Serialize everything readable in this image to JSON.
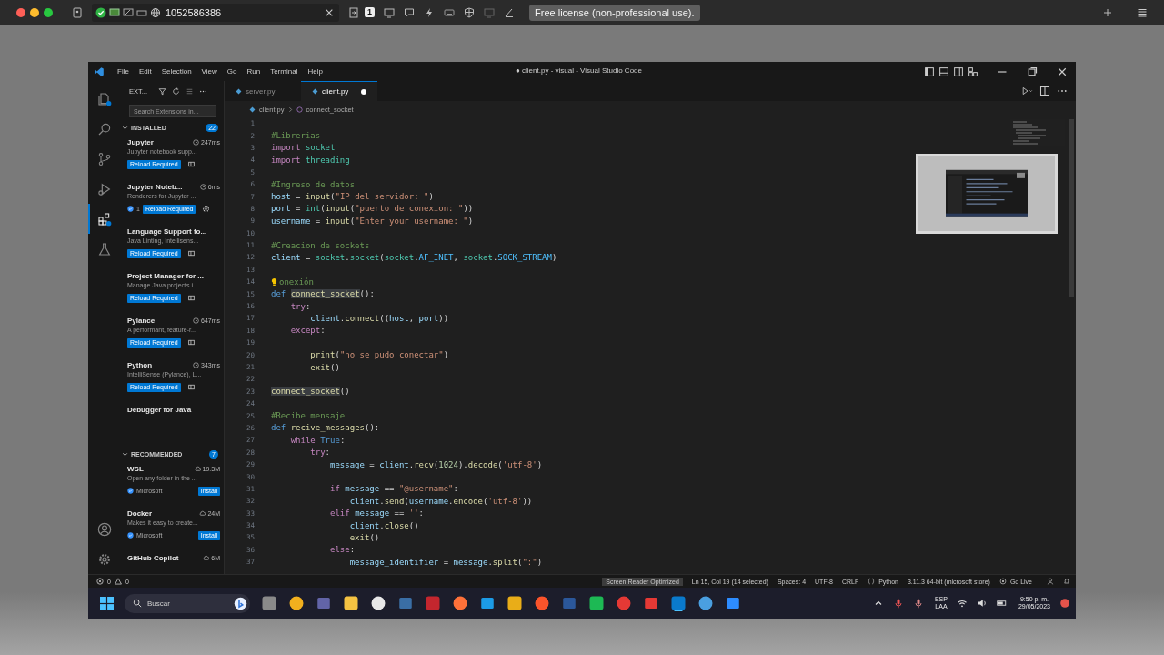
{
  "app_bar": {
    "connection_id": "1052586386",
    "screen_badge": "1",
    "license_label": "Free license (non-professional use)."
  },
  "vscode": {
    "menu": [
      "File",
      "Edit",
      "Selection",
      "View",
      "Go",
      "Run",
      "Terminal",
      "Help"
    ],
    "title": "● client.py - visual - Visual Studio Code",
    "activity_bar": {
      "top": [
        {
          "kind": "explorer",
          "selected": false
        },
        {
          "kind": "search",
          "selected": false
        },
        {
          "kind": "source-control",
          "selected": false
        },
        {
          "kind": "run",
          "selected": false
        },
        {
          "kind": "extensions",
          "selected": true
        },
        {
          "kind": "testing",
          "selected": false
        }
      ],
      "bottom": [
        {
          "kind": "account",
          "selected": false
        },
        {
          "kind": "settings",
          "selected": false
        }
      ]
    },
    "sidebar": {
      "title": "EXT...",
      "search_placeholder": "Search Extensions in...",
      "sections": [
        {
          "title": "INSTALLED",
          "count": "22",
          "kind": "installed",
          "expanded": true,
          "items": [
            {
              "name": "Jupyter",
              "meta": "247ms",
              "description": "Jupyter notebook supp...",
              "action": "Reload Required",
              "settings_icon": false
            },
            {
              "name": "Jupyter Noteb...",
              "meta": "6ms",
              "description": "Renderers for Jupyter ...",
              "badge": "1",
              "action": "Reload Required",
              "settings_icon": true
            },
            {
              "name": "Language Support fo...",
              "description": "Java Linting, Intellisens...",
              "action": "Reload Required",
              "settings_icon": false
            },
            {
              "name": "Project Manager for ...",
              "description": "Manage Java projects i...",
              "action": "Reload Required",
              "settings_icon": false
            },
            {
              "name": "Pylance",
              "meta": "647ms",
              "description": "A performant, feature-r...",
              "action": "Reload Required",
              "settings_icon": false
            },
            {
              "name": "Python",
              "meta": "343ms",
              "description": "IntelliSense (Pylance), L...",
              "action": "Reload Required",
              "settings_icon": false
            },
            {
              "name": "Debugger for Java"
            }
          ]
        },
        {
          "title": "RECOMMENDED",
          "count": "7",
          "kind": "recommended",
          "expanded": true,
          "items": [
            {
              "name": "WSL",
              "meta": "19.3M",
              "description": "Open any folder in the ...",
              "publisher": "Microsoft",
              "action": "Install"
            },
            {
              "name": "Docker",
              "meta": "24M",
              "description": "Makes it easy to create...",
              "publisher": "Microsoft",
              "action": "Install"
            },
            {
              "name": "GitHub Copilot",
              "meta": "6M"
            }
          ]
        }
      ]
    },
    "tabs": [
      {
        "label": "server.py",
        "selected": false,
        "modified": false
      },
      {
        "label": "client.py",
        "selected": true,
        "modified": true
      }
    ],
    "breadcrumbs": [
      "client.py",
      "connect_socket"
    ],
    "code": [
      {
        "number": "1"
      },
      {
        "number": "2",
        "tokens": [
          {
            "t": "#Librerias",
            "kind": "com"
          }
        ]
      },
      {
        "number": "3",
        "tokens": [
          {
            "t": "import",
            "kind": "ctl"
          },
          {
            "t": " socket",
            "kind": "cls"
          }
        ]
      },
      {
        "number": "4",
        "tokens": [
          {
            "t": "import",
            "kind": "ctl"
          },
          {
            "t": " threading",
            "kind": "cls"
          }
        ]
      },
      {
        "number": "5"
      },
      {
        "number": "6",
        "tokens": [
          {
            "t": "#Ingreso de datos",
            "kind": "com"
          }
        ]
      },
      {
        "number": "7",
        "tokens": [
          {
            "t": "host",
            "kind": "var"
          },
          {
            "t": " = ",
            "kind": "p"
          },
          {
            "t": "input",
            "kind": "fn"
          },
          {
            "t": "(",
            "kind": "p"
          },
          {
            "t": "\"IP del servidor: \"",
            "kind": "str"
          },
          {
            "t": ")",
            "kind": "p"
          }
        ]
      },
      {
        "number": "8",
        "tokens": [
          {
            "t": "port",
            "kind": "var"
          },
          {
            "t": " = ",
            "kind": "p"
          },
          {
            "t": "int",
            "kind": "cls"
          },
          {
            "t": "(",
            "kind": "p"
          },
          {
            "t": "input",
            "kind": "fn"
          },
          {
            "t": "(",
            "kind": "p"
          },
          {
            "t": "\"puerto de conexion: \"",
            "kind": "str"
          },
          {
            "t": "))",
            "kind": "p"
          }
        ]
      },
      {
        "number": "9",
        "tokens": [
          {
            "t": "username",
            "kind": "var"
          },
          {
            "t": " = ",
            "kind": "p"
          },
          {
            "t": "input",
            "kind": "fn"
          },
          {
            "t": "(",
            "kind": "p"
          },
          {
            "t": "\"Enter your username: \"",
            "kind": "str"
          },
          {
            "t": ")",
            "kind": "p"
          }
        ]
      },
      {
        "number": "10"
      },
      {
        "number": "11",
        "tokens": [
          {
            "t": "#Creacion de sockets",
            "kind": "com"
          }
        ]
      },
      {
        "number": "12",
        "tokens": [
          {
            "t": "client",
            "kind": "var"
          },
          {
            "t": " = ",
            "kind": "p"
          },
          {
            "t": "socket",
            "kind": "cls"
          },
          {
            "t": ".",
            "kind": "p"
          },
          {
            "t": "socket",
            "kind": "cls"
          },
          {
            "t": "(",
            "kind": "p"
          },
          {
            "t": "socket",
            "kind": "cls"
          },
          {
            "t": ".",
            "kind": "p"
          },
          {
            "t": "AF_INET",
            "kind": "const"
          },
          {
            "t": ", ",
            "kind": "p"
          },
          {
            "t": "socket",
            "kind": "cls"
          },
          {
            "t": ".",
            "kind": "p"
          },
          {
            "t": "SOCK_STREAM",
            "kind": "const"
          },
          {
            "t": ")",
            "kind": "p"
          }
        ]
      },
      {
        "number": "13"
      },
      {
        "number": "14",
        "lightbulb": true,
        "tokens": [
          {
            "t": "onexión",
            "kind": "com"
          }
        ]
      },
      {
        "number": "15",
        "tokens": [
          {
            "t": "def ",
            "kind": "kw"
          },
          {
            "t": "connect_socket",
            "kind": "sel"
          },
          {
            "t": "():",
            "kind": "p"
          }
        ]
      },
      {
        "number": "16",
        "tokens": [
          {
            "t": "    try",
            "kind": "ctl"
          },
          {
            "t": ":",
            "kind": "p"
          }
        ]
      },
      {
        "number": "17",
        "tokens": [
          {
            "t": "        client",
            "kind": "var"
          },
          {
            "t": ".",
            "kind": "p"
          },
          {
            "t": "connect",
            "kind": "fn"
          },
          {
            "t": "((",
            "kind": "p"
          },
          {
            "t": "host",
            "kind": "var"
          },
          {
            "t": ", ",
            "kind": "p"
          },
          {
            "t": "port",
            "kind": "var"
          },
          {
            "t": "))",
            "kind": "p"
          }
        ]
      },
      {
        "number": "18",
        "tokens": [
          {
            "t": "    except",
            "kind": "ctl"
          },
          {
            "t": ":",
            "kind": "p"
          }
        ]
      },
      {
        "number": "19"
      },
      {
        "number": "20",
        "tokens": [
          {
            "t": "        print",
            "kind": "fn"
          },
          {
            "t": "(",
            "kind": "p"
          },
          {
            "t": "\"no se pudo conectar\"",
            "kind": "str"
          },
          {
            "t": ")",
            "kind": "p"
          }
        ]
      },
      {
        "number": "21",
        "tokens": [
          {
            "t": "        exit",
            "kind": "fn"
          },
          {
            "t": "()",
            "kind": "p"
          }
        ]
      },
      {
        "number": "22"
      },
      {
        "number": "23",
        "tokens": [
          {
            "t": "connect_socket",
            "kind": "sel"
          },
          {
            "t": "()",
            "kind": "p"
          }
        ]
      },
      {
        "number": "24"
      },
      {
        "number": "25",
        "tokens": [
          {
            "t": "#Recibe mensaje",
            "kind": "com"
          }
        ]
      },
      {
        "number": "26",
        "tokens": [
          {
            "t": "def ",
            "kind": "kw"
          },
          {
            "t": "recive_messages",
            "kind": "fn"
          },
          {
            "t": "():",
            "kind": "p"
          }
        ]
      },
      {
        "number": "27",
        "tokens": [
          {
            "t": "    while ",
            "kind": "ctl"
          },
          {
            "t": "True",
            "kind": "kw"
          },
          {
            "t": ":",
            "kind": "p"
          }
        ]
      },
      {
        "number": "28",
        "tokens": [
          {
            "t": "        try",
            "kind": "ctl"
          },
          {
            "t": ":",
            "kind": "p"
          }
        ]
      },
      {
        "number": "29",
        "tokens": [
          {
            "t": "            message",
            "kind": "var"
          },
          {
            "t": " = ",
            "kind": "p"
          },
          {
            "t": "client",
            "kind": "var"
          },
          {
            "t": ".",
            "kind": "p"
          },
          {
            "t": "recv",
            "kind": "fn"
          },
          {
            "t": "(",
            "kind": "p"
          },
          {
            "t": "1024",
            "kind": "num"
          },
          {
            "t": ").",
            "kind": "p"
          },
          {
            "t": "decode",
            "kind": "fn"
          },
          {
            "t": "(",
            "kind": "p"
          },
          {
            "t": "'utf-8'",
            "kind": "str"
          },
          {
            "t": ")",
            "kind": "p"
          }
        ]
      },
      {
        "number": "30"
      },
      {
        "number": "31",
        "tokens": [
          {
            "t": "            if ",
            "kind": "ctl"
          },
          {
            "t": "message",
            "kind": "var"
          },
          {
            "t": " == ",
            "kind": "p"
          },
          {
            "t": "\"@username\"",
            "kind": "str"
          },
          {
            "t": ":",
            "kind": "p"
          }
        ]
      },
      {
        "number": "32",
        "tokens": [
          {
            "t": "                client",
            "kind": "var"
          },
          {
            "t": ".",
            "kind": "p"
          },
          {
            "t": "send",
            "kind": "fn"
          },
          {
            "t": "(",
            "kind": "p"
          },
          {
            "t": "username",
            "kind": "var"
          },
          {
            "t": ".",
            "kind": "p"
          },
          {
            "t": "encode",
            "kind": "fn"
          },
          {
            "t": "(",
            "kind": "p"
          },
          {
            "t": "'utf-8'",
            "kind": "str"
          },
          {
            "t": "))",
            "kind": "p"
          }
        ]
      },
      {
        "number": "33",
        "tokens": [
          {
            "t": "            elif ",
            "kind": "ctl"
          },
          {
            "t": "message",
            "kind": "var"
          },
          {
            "t": " == ",
            "kind": "p"
          },
          {
            "t": "''",
            "kind": "str"
          },
          {
            "t": ":",
            "kind": "p"
          }
        ]
      },
      {
        "number": "34",
        "tokens": [
          {
            "t": "                client",
            "kind": "var"
          },
          {
            "t": ".",
            "kind": "p"
          },
          {
            "t": "close",
            "kind": "fn"
          },
          {
            "t": "()",
            "kind": "p"
          }
        ]
      },
      {
        "number": "35",
        "tokens": [
          {
            "t": "                exit",
            "kind": "fn"
          },
          {
            "t": "()",
            "kind": "p"
          }
        ]
      },
      {
        "number": "36",
        "tokens": [
          {
            "t": "            else",
            "kind": "ctl"
          },
          {
            "t": ":",
            "kind": "p"
          }
        ]
      },
      {
        "number": "37",
        "tokens": [
          {
            "t": "                message_identifier",
            "kind": "var"
          },
          {
            "t": " = ",
            "kind": "p"
          },
          {
            "t": "message",
            "kind": "var"
          },
          {
            "t": ".",
            "kind": "p"
          },
          {
            "t": "split",
            "kind": "fn"
          },
          {
            "t": "(",
            "kind": "p"
          },
          {
            "t": "\":\"",
            "kind": "str"
          },
          {
            "t": ")",
            "kind": "p"
          }
        ]
      }
    ],
    "status_bar": {
      "errors": "0",
      "warnings": "0",
      "items": [
        {
          "text": "Screen Reader Optimized",
          "kind": "highlight"
        },
        {
          "text": "Ln 15, Col 19 (14 selected)",
          "kind": "plain"
        },
        {
          "text": "Spaces: 4",
          "kind": "plain"
        },
        {
          "text": "UTF-8",
          "kind": "plain"
        },
        {
          "text": "CRLF",
          "kind": "plain"
        },
        {
          "text": "Python",
          "kind": "language"
        },
        {
          "text": "3.11.3 64-bit (microsoft store)",
          "kind": "plain"
        },
        {
          "text": "Go Live",
          "kind": "live"
        }
      ]
    }
  },
  "taskbar": {
    "search_placeholder": "Buscar",
    "language": "ESP",
    "layout": "LAA",
    "time": "9:50 p. m.",
    "date": "29/05/2023"
  }
}
